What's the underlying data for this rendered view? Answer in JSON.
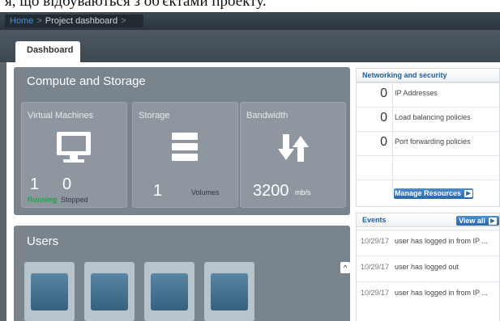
{
  "caption": {
    "text": "я, що відбуваються з об'єктами проекту."
  },
  "breadcrumb": {
    "home": "Home",
    "separator": ">",
    "current": "Project dashboard",
    "trailing_separator": ">"
  },
  "tabs": [
    {
      "label": "Dashboard",
      "active": true
    }
  ],
  "compute": {
    "title": "Compute and Storage",
    "virtual_machines": {
      "label": "Virtual Machines",
      "running_count": "1",
      "running_label": "Running",
      "stopped_count": "0",
      "stopped_label": "Stopped"
    },
    "storage": {
      "label": "Storage",
      "count": "1",
      "unit": "Volumes"
    },
    "bandwidth": {
      "label": "Bandwidth",
      "value": "3200",
      "unit": "mb/s"
    }
  },
  "users": {
    "title": "Users",
    "scroll_icon": "^"
  },
  "networking": {
    "title": "Networking and security",
    "rows": [
      {
        "count": "0",
        "label": "IP Addresses"
      },
      {
        "count": "0",
        "label": "Load balancing policies"
      },
      {
        "count": "0",
        "label": "Port forwarding policies"
      }
    ],
    "manage_button": "Manage Resources"
  },
  "events": {
    "title": "Events",
    "view_all": "View all",
    "items": [
      {
        "date": "10/29/17",
        "text": "user has logged in from IP ..."
      },
      {
        "date": "10/29/17",
        "text": "user has logged out"
      },
      {
        "date": "10/29/17",
        "text": "user has logged in from IP ..."
      }
    ]
  },
  "colors": {
    "accent": "#2b66a8",
    "running": "#1fa64a",
    "panel": "#7a848d",
    "tile": "#8e979f"
  }
}
